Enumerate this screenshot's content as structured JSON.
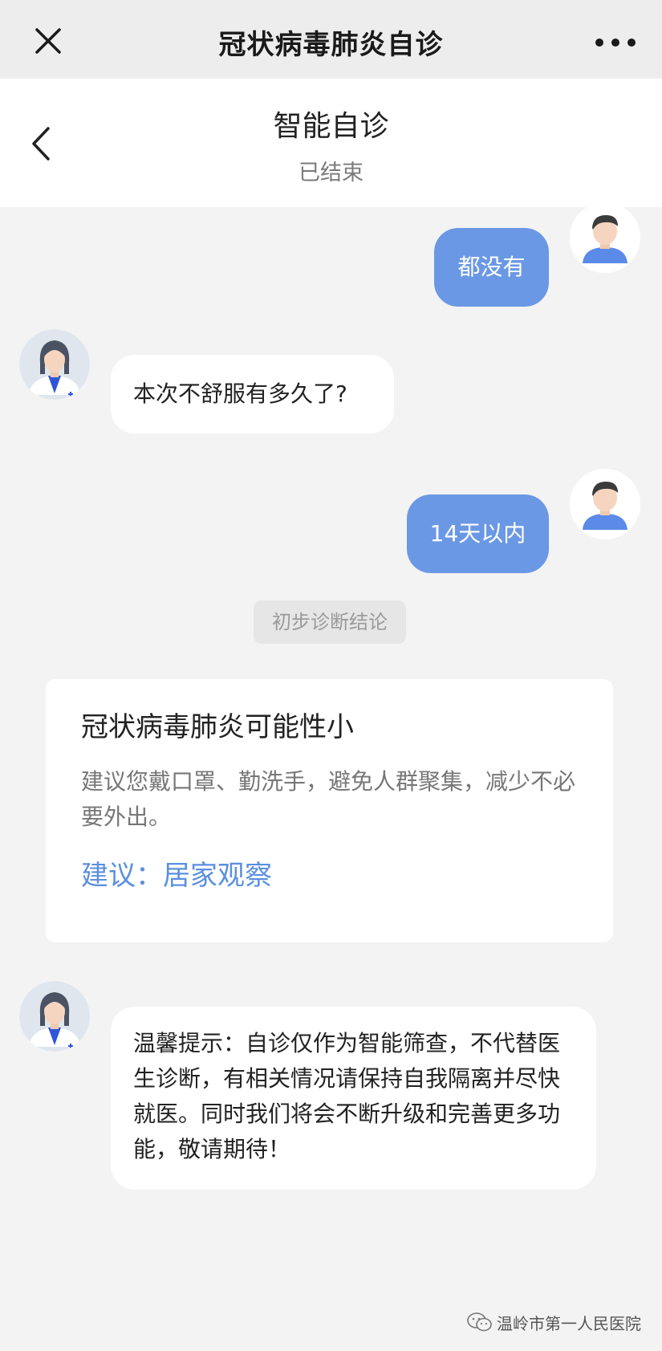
{
  "topbar": {
    "title": "冠状病毒肺炎自诊",
    "close_icon": "close-icon",
    "more_icon": "more-icon"
  },
  "header": {
    "title": "智能自诊",
    "status": "已结束",
    "back_icon": "chevron-left-icon"
  },
  "messages": [
    {
      "role": "user",
      "text": "都没有"
    },
    {
      "role": "bot",
      "text": "本次不舒服有多久了?"
    },
    {
      "role": "user",
      "text": "14天以内"
    }
  ],
  "divider": {
    "label": "初步诊断结论"
  },
  "result": {
    "title": "冠状病毒肺炎可能性小",
    "description": "建议您戴口罩、勤洗手，避免人群聚集，减少不必要外出。",
    "advice": "建议：居家观察"
  },
  "tip": {
    "text": "温馨提示：自诊仅作为智能筛查，不代替医生诊断，有相关情况请保持自我隔离并尽快就医。同时我们将会不断升级和完善更多功能，敬请期待！"
  },
  "watermark": {
    "text": "温岭市第一人民医院",
    "icon": "wechat-icon"
  },
  "colors": {
    "user_bubble": "#6b98e4",
    "accent": "#5b8fe0",
    "background": "#f3f3f3"
  }
}
